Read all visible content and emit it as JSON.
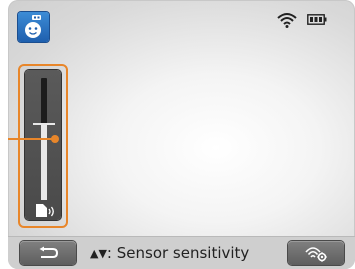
{
  "screen": {
    "mode_icon": "baby-face-mode-icon",
    "status": {
      "wifi_icon": "wifi-icon",
      "battery_icon": "battery-full-icon"
    }
  },
  "sensor_slider": {
    "level_fraction": 0.62,
    "icon": "sensor-sensitivity-icon",
    "highlight_color": "#e8862a"
  },
  "bottom_bar": {
    "back_icon": "back-arrow-icon",
    "instruction_arrows": "▲▼",
    "instruction_text": ": Sensor sensitivity",
    "sensor_button_icon": "sensor-settings-icon"
  }
}
